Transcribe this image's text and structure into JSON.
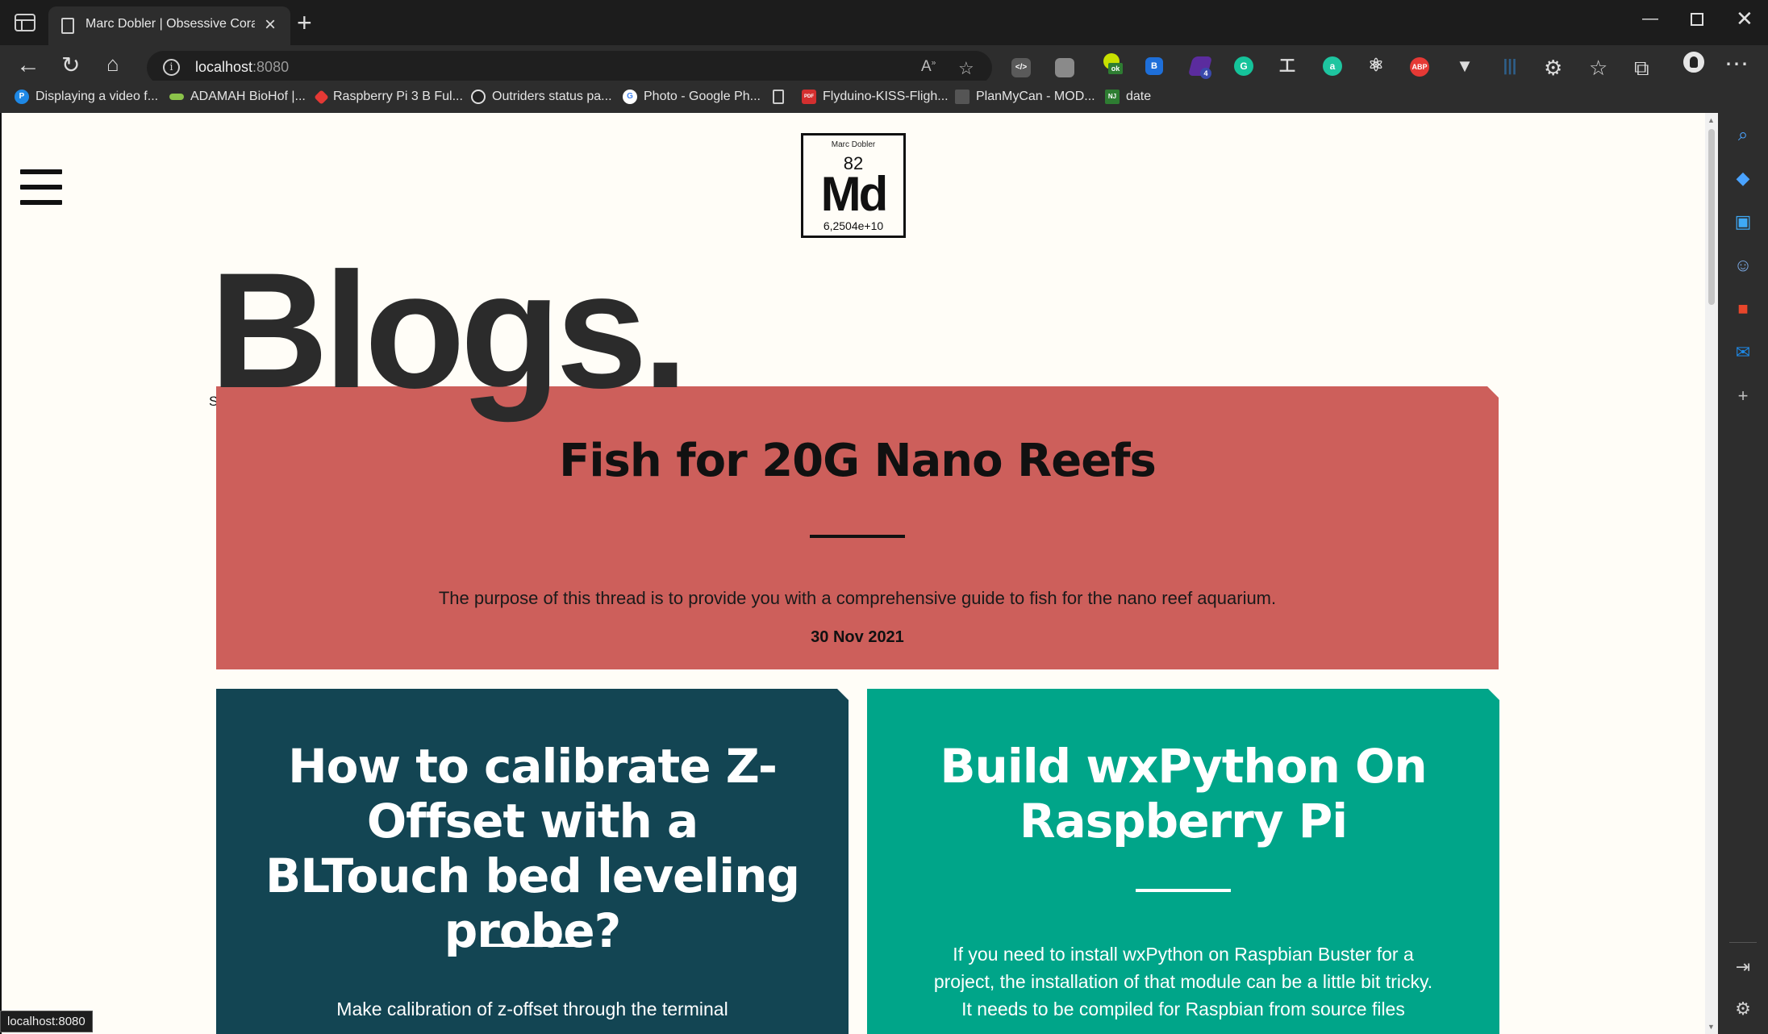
{
  "browser": {
    "tab_title": "Marc Dobler | Obsessive Coral D",
    "url_host": "localhost",
    "url_port": ":8080",
    "status_url": "localhost:8080",
    "bookmarks": [
      {
        "label": "Displaying a video f...",
        "icon": "p-circle-icon",
        "color": "#1e88e5",
        "glyph": "P"
      },
      {
        "label": "ADAMAH BioHof |...",
        "icon": "leaf-icon",
        "color": "#8bc34a",
        "glyph": ""
      },
      {
        "label": "Raspberry Pi 3 B Ful...",
        "icon": "gem-icon",
        "color": "#e53935",
        "glyph": ""
      },
      {
        "label": "Outriders status pa...",
        "icon": "outriders-icon",
        "color": "#222222",
        "glyph": "O"
      },
      {
        "label": "Photo - Google Ph...",
        "icon": "google-icon",
        "color": "#ffffff",
        "glyph": "G"
      },
      {
        "label": "Flyduino-KISS-Fligh...",
        "icon": "pdf-icon",
        "color": "#d32f2f",
        "glyph": "PDF"
      },
      {
        "label": "PlanMyCan - MOD...",
        "icon": "can-icon",
        "color": "#555555",
        "glyph": ""
      },
      {
        "label": "date",
        "icon": "nj-icon",
        "color": "#2e7d32",
        "glyph": "NJ"
      }
    ]
  },
  "page": {
    "logo": {
      "name": "Marc Dobler",
      "number": "82",
      "symbol": "Md",
      "mass": "6,2504e+10"
    },
    "title": "Blogs.",
    "stray_text": "S",
    "featured": {
      "title": "Fish for 20G Nano Reefs",
      "excerpt": "The purpose of this thread is to provide you with a comprehensive guide to fish for the nano reef aquarium.",
      "date": "30 Nov 2021",
      "color": "#cd5f5b"
    },
    "posts": [
      {
        "title": "How to calibrate Z-Offset with a BLTouch bed leveling probe?",
        "excerpt": "Make calibration of z-offset through the terminal",
        "color": "#134553"
      },
      {
        "title": "Build wxPython On Raspberry Pi",
        "excerpt": "If you need to install wxPython on Raspbian Buster for a project, the installation of that module can be a little bit tricky. It needs to be compiled for Raspbian from source files",
        "color": "#00a589"
      }
    ]
  }
}
